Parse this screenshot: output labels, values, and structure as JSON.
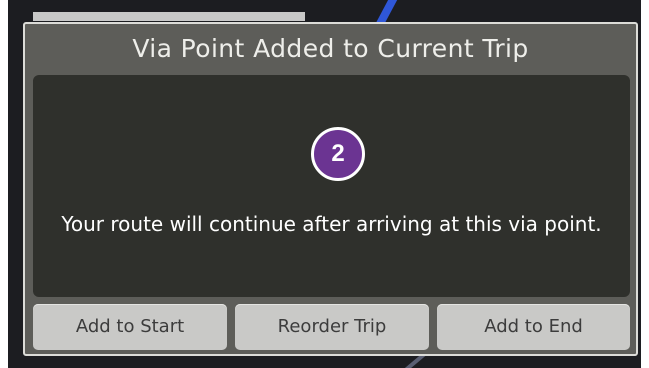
{
  "dialog": {
    "title": "Via Point Added to Current Trip",
    "step_number": "2",
    "message": "Your route will continue after arriving at this via point.",
    "buttons": {
      "add_to_start": "Add to Start",
      "reorder_trip": "Reorder Trip",
      "add_to_end": "Add to End"
    }
  },
  "colors": {
    "badge": "#6b3492",
    "dialog_frame": "#5d5d59",
    "content_bg": "#2f302c",
    "button_bg": "#c9c9c7"
  }
}
